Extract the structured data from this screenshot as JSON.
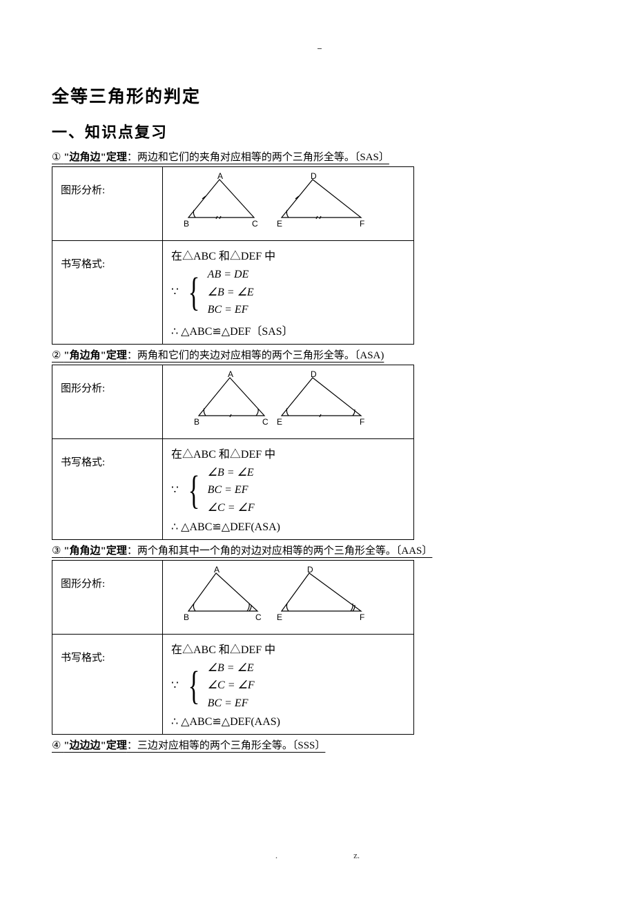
{
  "title": "全等三角形的判定",
  "section_heading": "一、知识点复习",
  "theorems": [
    {
      "num": "①",
      "name": "\"边角边\"定理",
      "desc": "：两边和它们的夹角对应相等的两个三角形全等。〔SAS〕",
      "label_diagram": "图形分析:",
      "label_format": "书写格式:",
      "given": "在△ABC 和△DEF 中",
      "l1": "AB = DE",
      "l2": "∠B = ∠E",
      "l3": "BC = EF",
      "concl": "∴ △ABC≌△DEF〔SAS〕"
    },
    {
      "num": "②",
      "name": "\"角边角\"定理",
      "desc": "：两角和它们的夹边对应相等的两个三角形全等。〔ASA)",
      "label_diagram": "图形分析:",
      "label_format": "书写格式:",
      "given": "在△ABC 和△DEF 中",
      "l1": "∠B = ∠E",
      "l2": "BC = EF",
      "l3": "∠C = ∠F",
      "concl": "∴ △ABC≌△DEF(ASA)"
    },
    {
      "num": "③",
      "name": "\"角角边\"定理",
      "desc": "：两个角和其中一个角的对边对应相等的两个三角形全等。〔AAS〕",
      "label_diagram": "图形分析:",
      "label_format": "书写格式:",
      "given": "在△ABC 和△DEF 中",
      "l1": "∠B = ∠E",
      "l2": "∠C = ∠F",
      "l3": "BC = EF",
      "concl": "∴ △ABC≌△DEF(AAS)"
    }
  ],
  "tail_line": {
    "num": "④",
    "name": "\"边边边\"定理",
    "desc": "：三边对应相等的两个三角形全等。〔SSS〕"
  },
  "footer_left": ".",
  "footer_right": "z."
}
